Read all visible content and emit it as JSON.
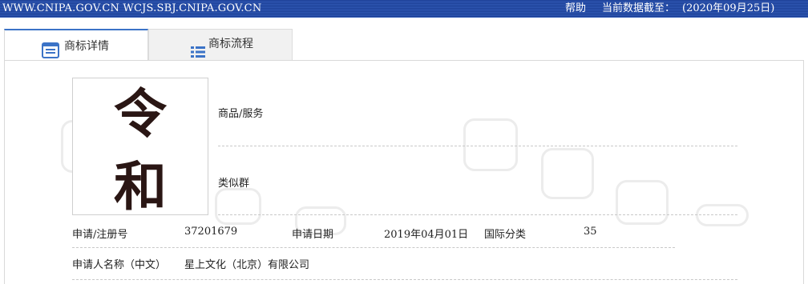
{
  "topbar": {
    "site": "WWW.CNIPA.GOV.CN WCJS.SBJ.CNIPA.GOV.CN",
    "help": "帮助",
    "date_label": "当前数据截至：",
    "date_value": "(2020年09月25日)"
  },
  "tabs": [
    {
      "label": "商标详情",
      "icon": "document-icon",
      "active": true
    },
    {
      "label": "商标流程",
      "icon": "list-icon",
      "active": false
    }
  ],
  "trademark": {
    "mark_chars": [
      "令",
      "和"
    ],
    "goods_services_label": "商品/服务",
    "similar_group_label": "类似群"
  },
  "fields": {
    "reg_no_label": "申请/注册号",
    "reg_no_value": "37201679",
    "apply_date_label": "申请日期",
    "apply_date_value": "2019年04月01日",
    "intl_class_label": "国际分类",
    "intl_class_value": "35",
    "applicant_label": "申请人名称（中文）",
    "applicant_value": "星上文化（北京）有限公司"
  },
  "colors": {
    "topbar": "#2f59b4",
    "tab_accent": "#3b73c7",
    "mark_ink": "#2a1614"
  }
}
